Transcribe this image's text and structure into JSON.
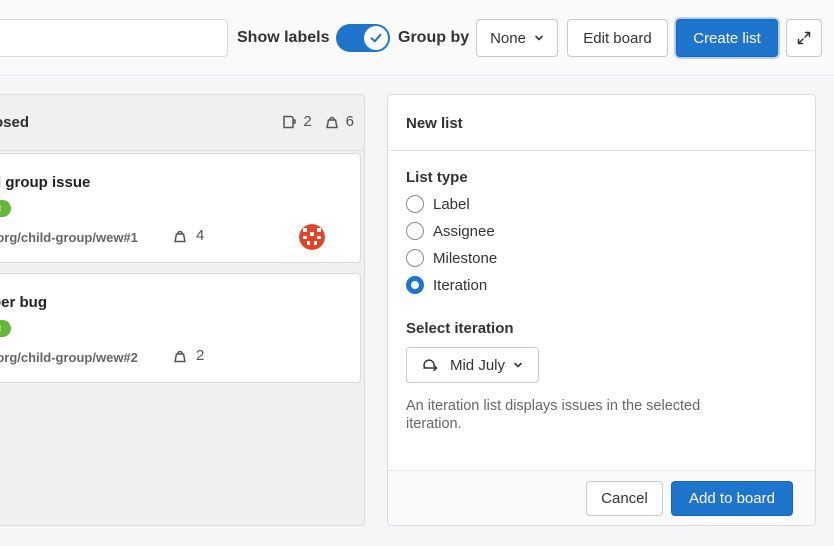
{
  "toolbar": {
    "search_value": "",
    "show_labels": "Show labels",
    "show_labels_on": true,
    "group_by": "Group by",
    "group_by_value": "None",
    "edit_board": "Edit board",
    "create_list": "Create list"
  },
  "column": {
    "title": "osed",
    "issue_count": "2",
    "weight_total": "6",
    "cards": [
      {
        "title": "d group issue",
        "label": "g",
        "ref": "-org/child-group/wew#1",
        "weight": "4"
      },
      {
        "title": "ber bug",
        "label": "g",
        "ref": "-org/child-group/wew#2",
        "weight": "2"
      }
    ]
  },
  "panel": {
    "title": "New list",
    "list_type_label": "List type",
    "options": [
      "Label",
      "Assignee",
      "Milestone",
      "Iteration"
    ],
    "selected_option": "Iteration",
    "select_iteration_label": "Select iteration",
    "iteration_value": "Mid July",
    "help_text": "An iteration list displays issues in the selected iteration.",
    "cancel": "Cancel",
    "add_to_board": "Add to board"
  },
  "colors": {
    "primary": "#1f75cb",
    "label_green": "#65b73b",
    "avatar": "#e24329"
  }
}
